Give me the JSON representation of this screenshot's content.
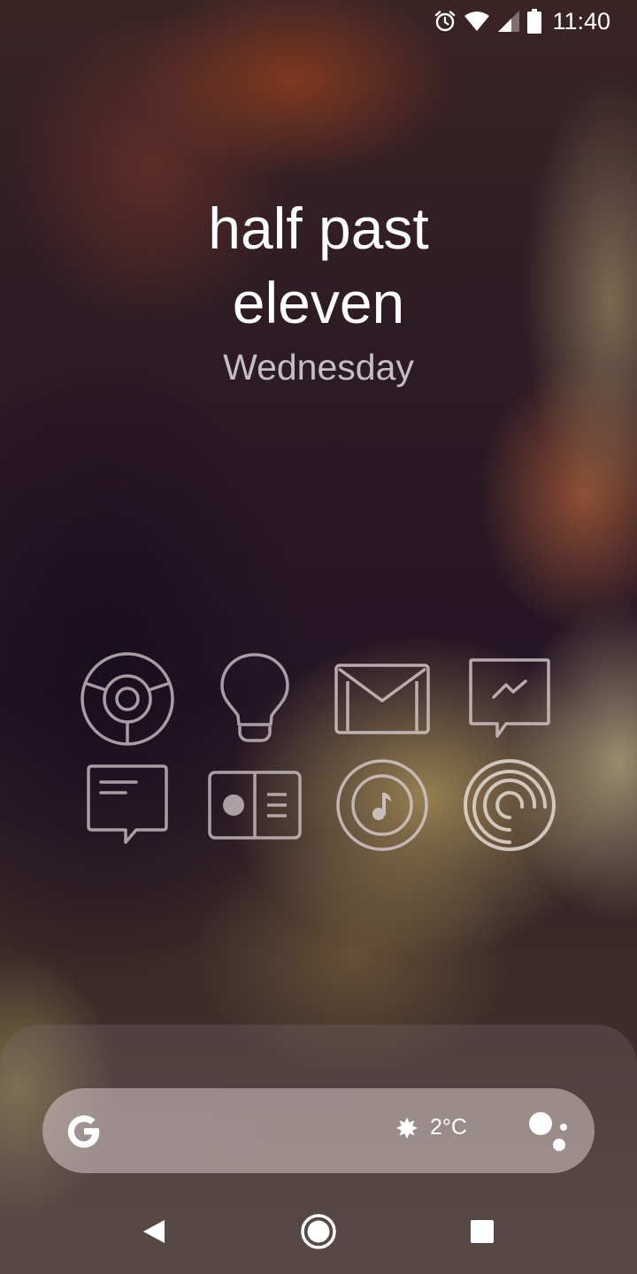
{
  "status_bar": {
    "time": "11:40",
    "icons": [
      "alarm-icon",
      "wifi-icon",
      "signal-icon",
      "battery-icon"
    ]
  },
  "clock": {
    "line1": "half past",
    "line2": "eleven",
    "day": "Wednesday"
  },
  "apps": [
    {
      "icon": "chrome-icon"
    },
    {
      "icon": "lightbulb-icon"
    },
    {
      "icon": "gmail-icon"
    },
    {
      "icon": "messenger-icon"
    },
    {
      "icon": "messages-icon"
    },
    {
      "icon": "contacts-card-icon"
    },
    {
      "icon": "music-icon"
    },
    {
      "icon": "podcast-icon"
    }
  ],
  "search": {
    "logo": "google-g-icon",
    "weather_icon": "sun-icon",
    "temperature": "2°C",
    "assistant_icon": "google-assistant-icon"
  },
  "nav": {
    "back": "back-icon",
    "home": "home-icon",
    "recents": "recents-icon"
  },
  "colors": {
    "icon_stroke": "#d7ccd0",
    "text": "#ffffff",
    "day_text": "#d4cbd0"
  }
}
